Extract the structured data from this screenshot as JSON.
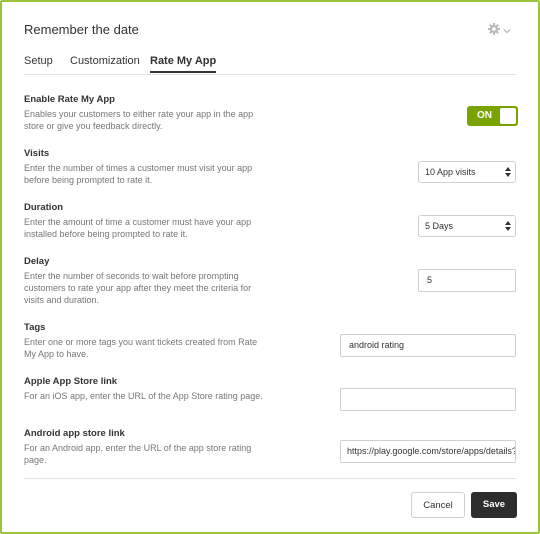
{
  "dialog": {
    "title": "Remember the date",
    "settings_icon": "gear-icon",
    "dropdown_icon": "chevron-down-icon"
  },
  "tabs": [
    {
      "label": "Setup",
      "active": false
    },
    {
      "label": "Customization",
      "active": false
    },
    {
      "label": "Rate My App",
      "active": true
    }
  ],
  "fields": {
    "enable": {
      "label": "Enable Rate My App",
      "description": "Enables your customers to either rate your app in the app store or give you feedback directly.",
      "toggle": "ON"
    },
    "visits": {
      "label": "Visits",
      "description": "Enter the number of times a customer must visit your app before being prompted to rate it.",
      "value": "10 App visits"
    },
    "duration": {
      "label": "Duration",
      "description": "Enter the amount of time a customer must have your app installed before being prompted to rate it.",
      "value": "5 Days"
    },
    "delay": {
      "label": "Delay",
      "description": "Enter the number of seconds to wait before prompting customers to rate your app after they meet the criteria for visits and duration.",
      "value": "5"
    },
    "tags": {
      "label": "Tags",
      "description": "Enter one or more tags you want tickets created from Rate My App to have.",
      "value": "android rating"
    },
    "apple": {
      "label": "Apple App Store link",
      "description": "For an iOS app, enter the URL of the App Store rating page.",
      "value": ""
    },
    "android": {
      "label": "Android app store link",
      "description": "For an Android app, enter the URL of the app store rating page.",
      "value": "https://play.google.com/store/apps/details?"
    }
  },
  "buttons": {
    "cancel": "Cancel",
    "save": "Save"
  },
  "colors": {
    "accent": "#9bc43b",
    "toggle_on": "#78a300",
    "save_button": "#2d2d2d"
  }
}
